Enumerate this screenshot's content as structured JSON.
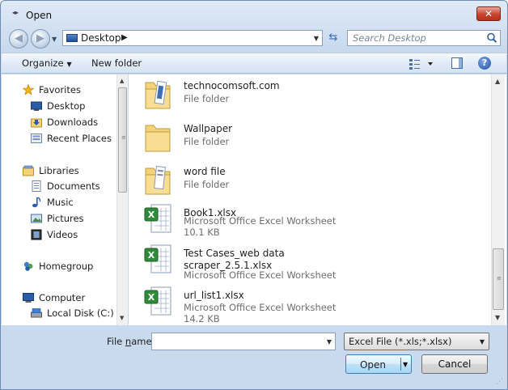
{
  "window": {
    "title": "Open"
  },
  "address": {
    "location": "Desktop",
    "separator": "▶"
  },
  "search": {
    "placeholder": "Search Desktop"
  },
  "toolbar": {
    "organize_label": "Organize",
    "new_folder_label": "New folder"
  },
  "nav": {
    "favorites": {
      "label": "Favorites",
      "items": [
        "Desktop",
        "Downloads",
        "Recent Places"
      ]
    },
    "libraries": {
      "label": "Libraries",
      "items": [
        "Documents",
        "Music",
        "Pictures",
        "Videos"
      ]
    },
    "homegroup": {
      "label": "Homegroup"
    },
    "computer": {
      "label": "Computer",
      "items": [
        "Local Disk (C:)"
      ]
    }
  },
  "files": [
    {
      "name": "technocomsoft.com",
      "type": "File folder",
      "size": "",
      "kind": "folder"
    },
    {
      "name": "Wallpaper",
      "type": "File folder",
      "size": "",
      "kind": "folder"
    },
    {
      "name": "word file",
      "type": "File folder",
      "size": "",
      "kind": "folder"
    },
    {
      "name": "Book1.xlsx",
      "type": "Microsoft Office Excel Worksheet",
      "size": "10.1 KB",
      "kind": "excel"
    },
    {
      "name": "Test Cases_web data",
      "name2": "scraper_2.5.1.xlsx",
      "type": "Microsoft Office Excel Worksheet",
      "size": "",
      "kind": "excel"
    },
    {
      "name": "url_list1.xlsx",
      "type": "Microsoft Office Excel Worksheet",
      "size": "14.2 KB",
      "kind": "excel"
    }
  ],
  "bottom": {
    "file_name_label_pre": "File ",
    "file_name_label_ul": "n",
    "file_name_label_post": "ame:",
    "file_name_value": "",
    "filter": "Excel File (*.xls;*.xlsx)",
    "open_label": "Open",
    "cancel_label": "Cancel"
  },
  "colors": {
    "accent": "#3c7fb1",
    "title_close": "#c9442f",
    "folder": "#f3d27a",
    "excel": "#2f8a3a"
  }
}
